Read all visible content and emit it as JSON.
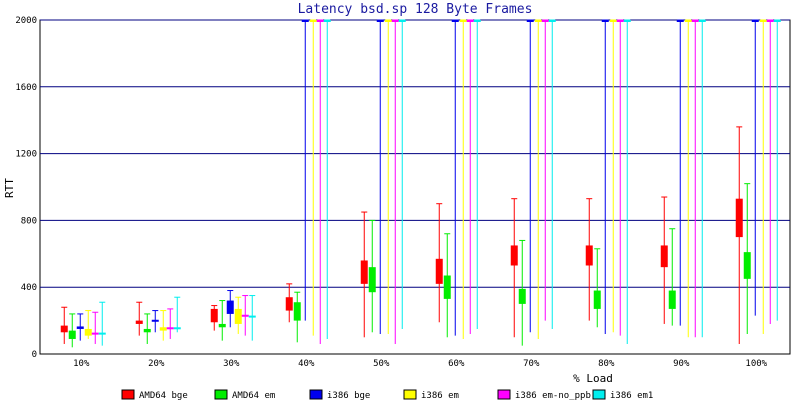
{
  "chart_data": {
    "type": "boxplot",
    "title": "Latency bsd.sp 128 Byte Frames",
    "xlabel": "% Load",
    "ylabel": "RTT",
    "ylim": [
      0,
      2000
    ],
    "yticks": [
      "0",
      "400",
      "800",
      "1200",
      "1600",
      "2000"
    ],
    "categories": [
      "10%",
      "20%",
      "30%",
      "40%",
      "50%",
      "60%",
      "70%",
      "80%",
      "90%",
      "100%"
    ],
    "grid": true,
    "legend_position": "bottom",
    "series": [
      {
        "name": "AMD64 bge",
        "color": "#ff0000",
        "data": [
          {
            "min": 60,
            "q1": 130,
            "q3": 170,
            "max": 280
          },
          {
            "min": 110,
            "q1": 180,
            "q3": 200,
            "max": 310
          },
          {
            "min": 140,
            "q1": 190,
            "q3": 270,
            "max": 290
          },
          {
            "min": 190,
            "q1": 260,
            "q3": 340,
            "max": 420
          },
          {
            "min": 100,
            "q1": 420,
            "q3": 560,
            "max": 850
          },
          {
            "min": 190,
            "q1": 420,
            "q3": 570,
            "max": 900
          },
          {
            "min": 100,
            "q1": 530,
            "q3": 650,
            "max": 930
          },
          {
            "min": 200,
            "q1": 530,
            "q3": 650,
            "max": 930
          },
          {
            "min": 180,
            "q1": 520,
            "q3": 650,
            "max": 940
          },
          {
            "min": 60,
            "q1": 700,
            "q3": 930,
            "max": 1360
          }
        ]
      },
      {
        "name": "AMD64 em",
        "color": "#00ee00",
        "data": [
          {
            "min": 40,
            "q1": 90,
            "q3": 140,
            "max": 240
          },
          {
            "min": 60,
            "q1": 130,
            "q3": 150,
            "max": 240
          },
          {
            "min": 80,
            "q1": 160,
            "q3": 180,
            "max": 320
          },
          {
            "min": 70,
            "q1": 200,
            "q3": 310,
            "max": 370
          },
          {
            "min": 130,
            "q1": 370,
            "q3": 520,
            "max": 800
          },
          {
            "min": 100,
            "q1": 330,
            "q3": 470,
            "max": 720
          },
          {
            "min": 50,
            "q1": 300,
            "q3": 390,
            "max": 680
          },
          {
            "min": 160,
            "q1": 270,
            "q3": 380,
            "max": 630
          },
          {
            "min": 170,
            "q1": 270,
            "q3": 380,
            "max": 750
          },
          {
            "min": 120,
            "q1": 450,
            "q3": 610,
            "max": 1020
          }
        ]
      },
      {
        "name": "i386 bge",
        "color": "#0000ee",
        "data": [
          {
            "min": 80,
            "q1": 150,
            "q3": 165,
            "max": 240
          },
          {
            "min": 130,
            "q1": 195,
            "q3": 205,
            "max": 260
          },
          {
            "min": 160,
            "q1": 240,
            "q3": 320,
            "max": 380
          },
          {
            "min": 200,
            "q1": 2000,
            "q3": 2000,
            "max": 2000
          },
          {
            "min": 120,
            "q1": 2000,
            "q3": 2000,
            "max": 2000
          },
          {
            "min": 110,
            "q1": 2000,
            "q3": 2000,
            "max": 2000
          },
          {
            "min": 130,
            "q1": 2000,
            "q3": 2000,
            "max": 2000
          },
          {
            "min": 120,
            "q1": 2000,
            "q3": 2000,
            "max": 2000
          },
          {
            "min": 170,
            "q1": 2000,
            "q3": 2000,
            "max": 2000
          },
          {
            "min": 230,
            "q1": 2000,
            "q3": 2000,
            "max": 2000
          }
        ]
      },
      {
        "name": "i386 em",
        "color": "#ffff00",
        "data": [
          {
            "min": 90,
            "q1": 110,
            "q3": 150,
            "max": 260
          },
          {
            "min": 80,
            "q1": 140,
            "q3": 160,
            "max": 260
          },
          {
            "min": 120,
            "q1": 180,
            "q3": 270,
            "max": 340
          },
          {
            "min": 110,
            "q1": 2000,
            "q3": 2000,
            "max": 2000
          },
          {
            "min": 120,
            "q1": 2000,
            "q3": 2000,
            "max": 2000
          },
          {
            "min": 90,
            "q1": 2000,
            "q3": 2000,
            "max": 2000
          },
          {
            "min": 90,
            "q1": 2000,
            "q3": 2000,
            "max": 2000
          },
          {
            "min": 130,
            "q1": 2000,
            "q3": 2000,
            "max": 2000
          },
          {
            "min": 100,
            "q1": 2000,
            "q3": 2000,
            "max": 2000
          },
          {
            "min": 120,
            "q1": 2000,
            "q3": 2000,
            "max": 2000
          }
        ]
      },
      {
        "name": "i386 em-no_ppb",
        "color": "#ff00ff",
        "data": [
          {
            "min": 60,
            "q1": 118,
            "q3": 128,
            "max": 250
          },
          {
            "min": 90,
            "q1": 150,
            "q3": 160,
            "max": 270
          },
          {
            "min": 110,
            "q1": 225,
            "q3": 235,
            "max": 350
          },
          {
            "min": 60,
            "q1": 2000,
            "q3": 2000,
            "max": 2000
          },
          {
            "min": 60,
            "q1": 2000,
            "q3": 2000,
            "max": 2000
          },
          {
            "min": 120,
            "q1": 2000,
            "q3": 2000,
            "max": 2000
          },
          {
            "min": 200,
            "q1": 2000,
            "q3": 2000,
            "max": 2000
          },
          {
            "min": 110,
            "q1": 2000,
            "q3": 2000,
            "max": 2000
          },
          {
            "min": 100,
            "q1": 2000,
            "q3": 2000,
            "max": 2000
          },
          {
            "min": 180,
            "q1": 2000,
            "q3": 2000,
            "max": 2000
          }
        ]
      },
      {
        "name": "i386 em1",
        "color": "#00eeee",
        "data": [
          {
            "min": 50,
            "q1": 118,
            "q3": 128,
            "max": 310
          },
          {
            "min": 130,
            "q1": 150,
            "q3": 160,
            "max": 340
          },
          {
            "min": 80,
            "q1": 220,
            "q3": 230,
            "max": 350
          },
          {
            "min": 90,
            "q1": 2000,
            "q3": 2000,
            "max": 2000
          },
          {
            "min": 150,
            "q1": 2000,
            "q3": 2000,
            "max": 2000
          },
          {
            "min": 150,
            "q1": 2000,
            "q3": 2000,
            "max": 2000
          },
          {
            "min": 150,
            "q1": 2000,
            "q3": 2000,
            "max": 2000
          },
          {
            "min": 60,
            "q1": 2000,
            "q3": 2000,
            "max": 2000
          },
          {
            "min": 100,
            "q1": 2000,
            "q3": 2000,
            "max": 2000
          },
          {
            "min": 200,
            "q1": 2000,
            "q3": 2000,
            "max": 2000
          }
        ]
      }
    ]
  }
}
